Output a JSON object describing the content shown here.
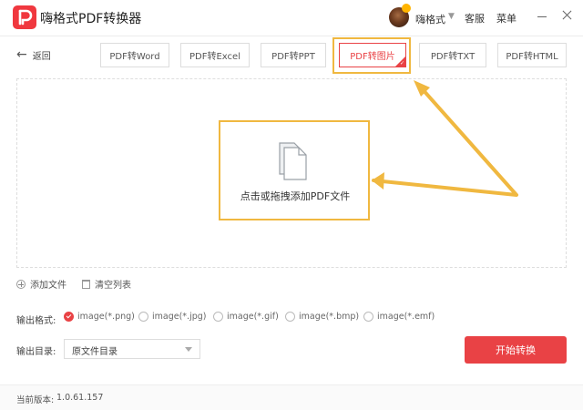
{
  "app": {
    "title": "嗨格式PDF转换器",
    "username": "嗨格式",
    "service": "客服",
    "menu": "菜单"
  },
  "nav": {
    "back": "返回"
  },
  "tabs": [
    {
      "label": "PDF转Word"
    },
    {
      "label": "PDF转Excel"
    },
    {
      "label": "PDF转PPT"
    },
    {
      "label": "PDF转图片",
      "active": true
    },
    {
      "label": "PDF转TXT"
    },
    {
      "label": "PDF转HTML"
    }
  ],
  "drop": {
    "text": "点击或拖拽添加PDF文件"
  },
  "actions": {
    "add_file": "添加文件",
    "clear_list": "清空列表"
  },
  "output": {
    "format_label": "输出格式:",
    "formats": [
      {
        "label": "image(*.png)",
        "checked": true
      },
      {
        "label": "image(*.jpg)"
      },
      {
        "label": "image(*.gif)"
      },
      {
        "label": "image(*.bmp)"
      },
      {
        "label": "image(*.emf)"
      }
    ],
    "dir_label": "输出目录:",
    "dir_value": "原文件目录"
  },
  "convert": "开始转换",
  "footer": {
    "version_label": "当前版本:",
    "version": "1.0.61.157"
  },
  "colors": {
    "accent": "#e94245",
    "highlight": "#f0b840"
  }
}
